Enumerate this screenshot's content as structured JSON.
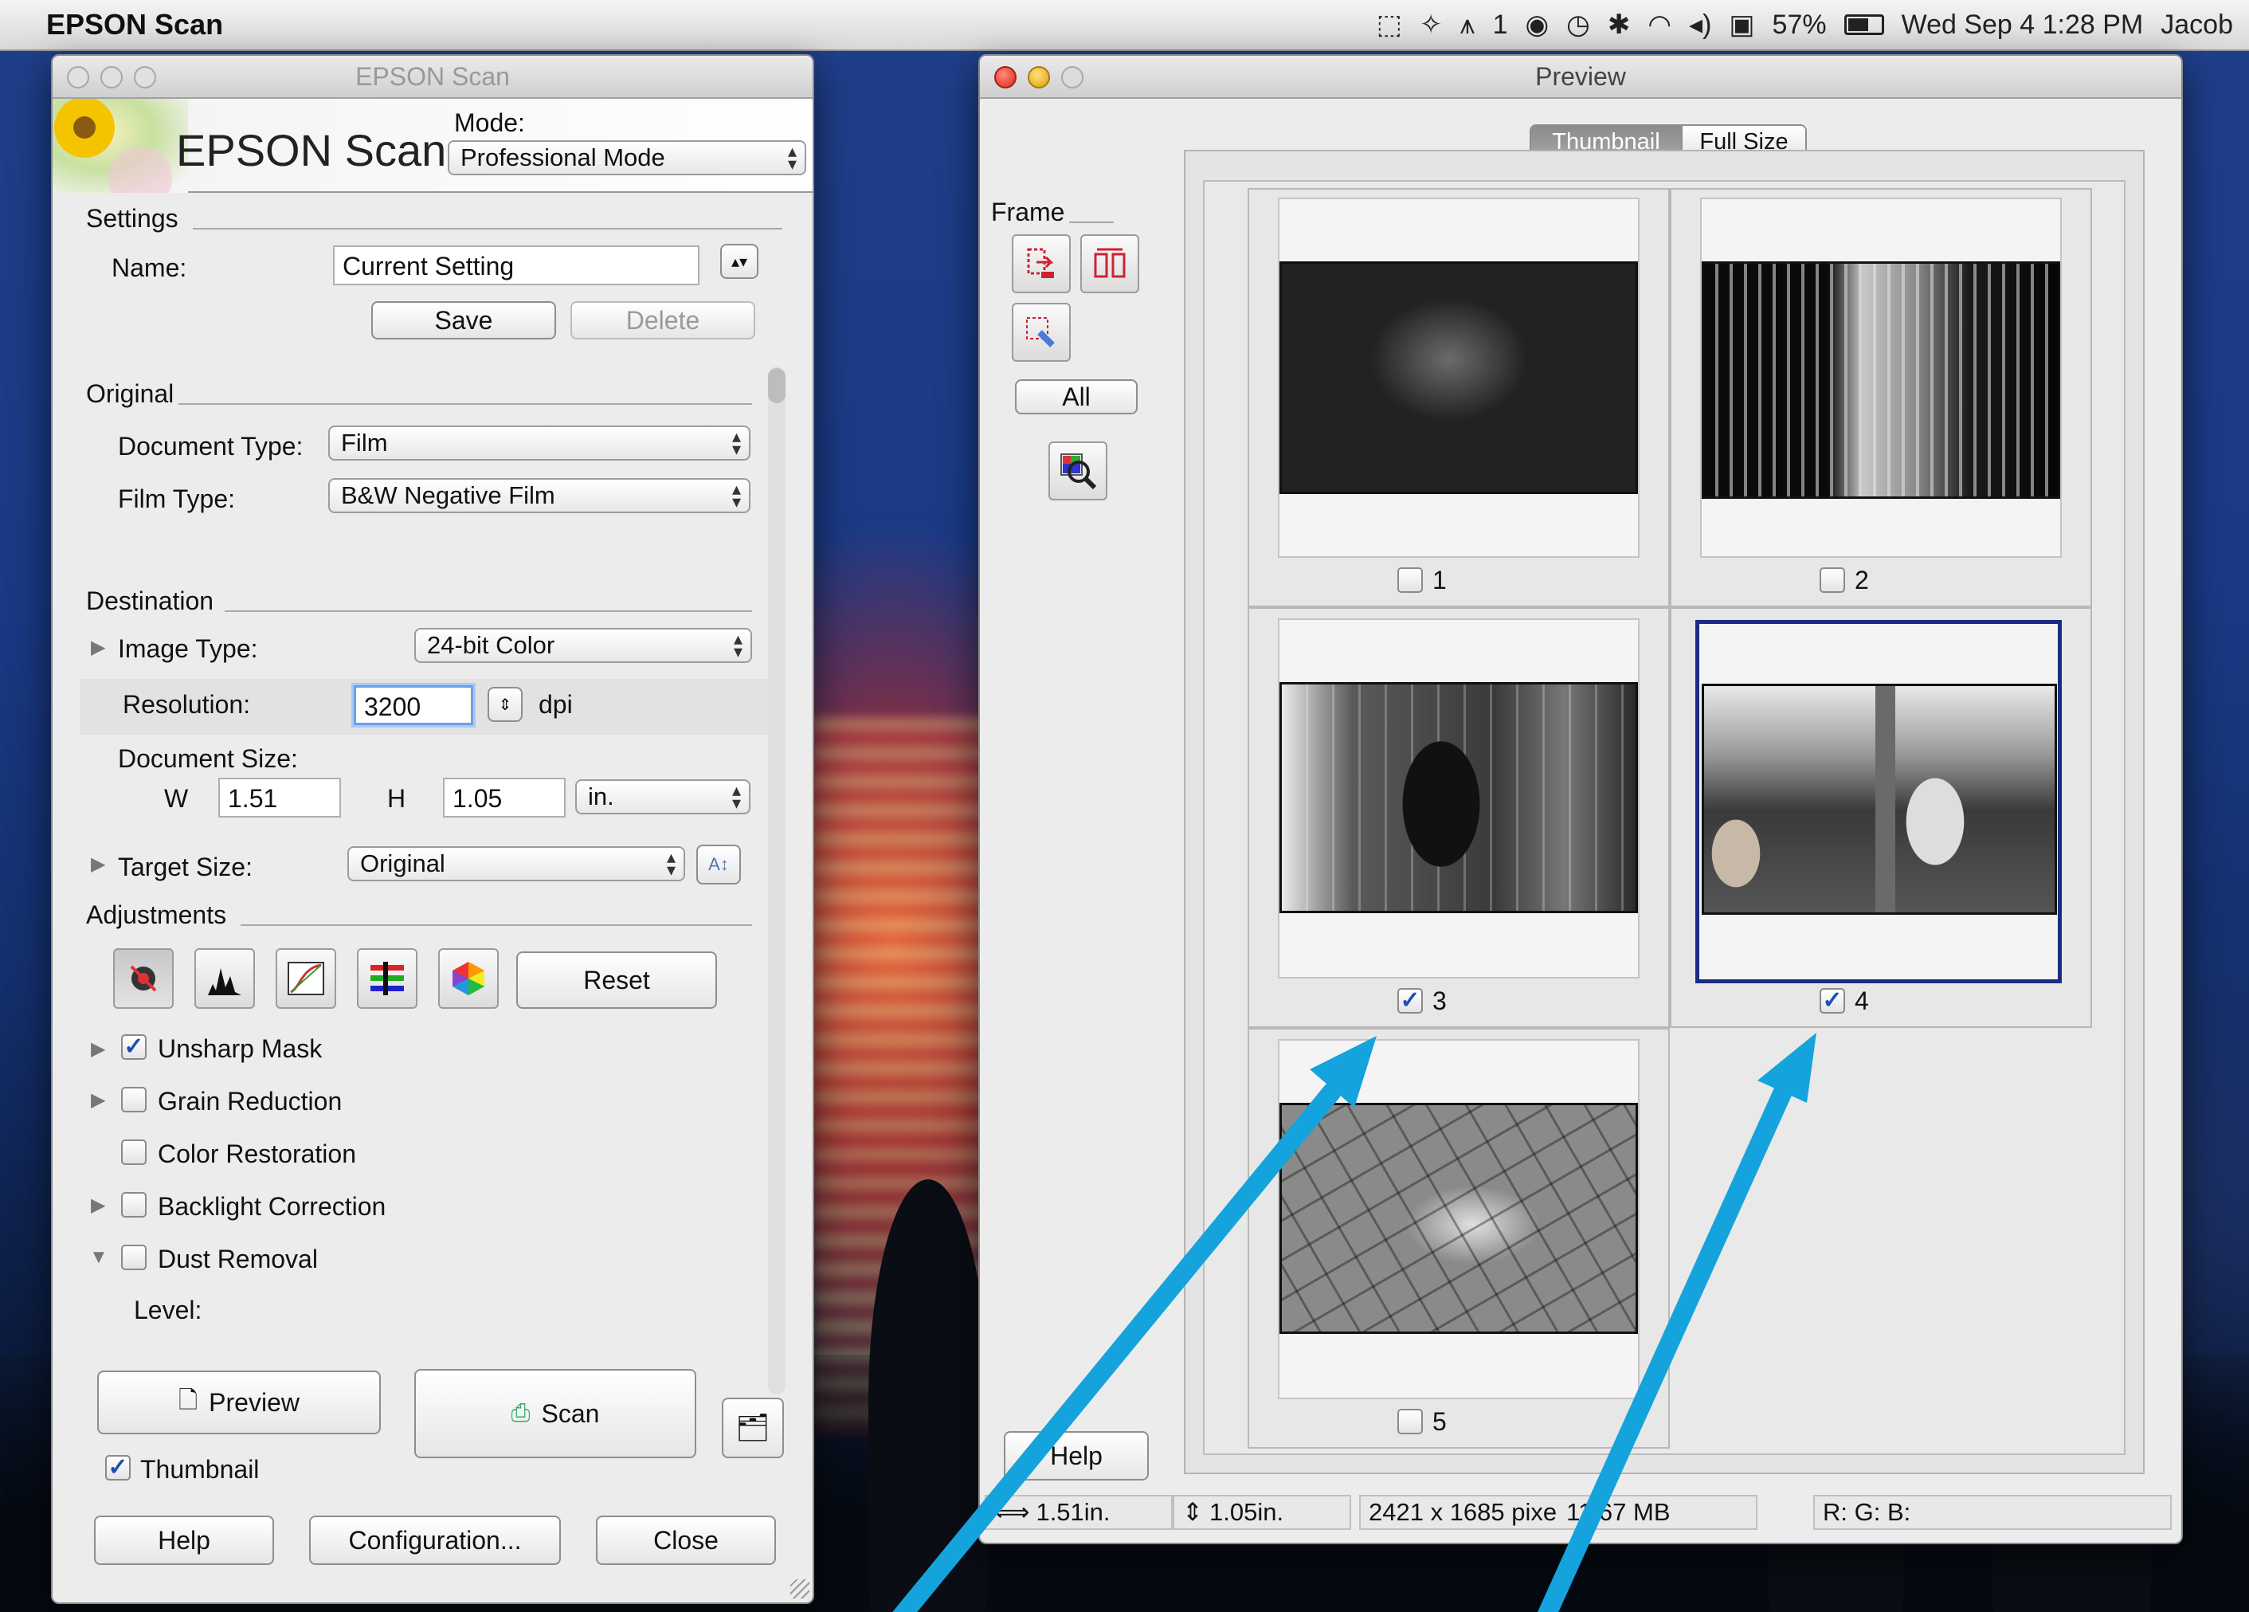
{
  "menubar": {
    "app_name": "EPSON Scan",
    "input_badge": "1",
    "battery": "57%",
    "datetime": "Wed Sep 4  1:28 PM",
    "user": "Jacob"
  },
  "scan_window": {
    "title": "EPSON Scan",
    "brand": "EPSON Scan",
    "mode_label": "Mode:",
    "mode_value": "Professional Mode",
    "settings": {
      "heading": "Settings",
      "name_label": "Name:",
      "name_value": "Current Setting",
      "save": "Save",
      "delete": "Delete"
    },
    "original": {
      "heading": "Original",
      "doc_type_label": "Document Type:",
      "doc_type_value": "Film",
      "film_type_label": "Film Type:",
      "film_type_value": "B&W Negative Film"
    },
    "destination": {
      "heading": "Destination",
      "image_type_label": "Image Type:",
      "image_type_value": "24-bit Color",
      "resolution_label": "Resolution:",
      "resolution_value": "3200",
      "resolution_unit": "dpi",
      "doc_size_label": "Document Size:",
      "w_label": "W",
      "w_value": "1.51",
      "h_label": "H",
      "h_value": "1.05",
      "unit_value": "in.",
      "target_size_label": "Target Size:",
      "target_size_value": "Original"
    },
    "adjustments": {
      "heading": "Adjustments",
      "reset": "Reset",
      "items": [
        {
          "label": "Unsharp Mask",
          "checked": true
        },
        {
          "label": "Grain Reduction",
          "checked": false
        },
        {
          "label": "Color Restoration",
          "checked": false
        },
        {
          "label": "Backlight Correction",
          "checked": false
        },
        {
          "label": "Dust Removal",
          "checked": false
        }
      ],
      "level_label": "Level:"
    },
    "preview": "Preview",
    "scan": "Scan",
    "thumbnail": "Thumbnail",
    "thumbnail_checked": true,
    "help": "Help",
    "configuration": "Configuration...",
    "close": "Close"
  },
  "preview_window": {
    "title": "Preview",
    "tabs": {
      "thumbnail": "Thumbnail",
      "full_size": "Full Size",
      "active": "thumbnail"
    },
    "frame_label": "Frame",
    "all": "All",
    "help": "Help",
    "frames": [
      {
        "number": "1",
        "checked": false
      },
      {
        "number": "2",
        "checked": false
      },
      {
        "number": "3",
        "checked": true
      },
      {
        "number": "4",
        "checked": true,
        "selected": true
      },
      {
        "number": "5",
        "checked": false
      }
    ],
    "status": {
      "width": "1.51in.",
      "height": "1.05in.",
      "pixels": "2421 x 1685 pixe",
      "size": "11.67 MB",
      "rgb": "R: G: B:"
    }
  },
  "annotation": {
    "arrow_color": "#14a3dc"
  },
  "colors": {
    "selected_frame": "#1a2d82",
    "checkbox_check": "#1b4fb0"
  }
}
